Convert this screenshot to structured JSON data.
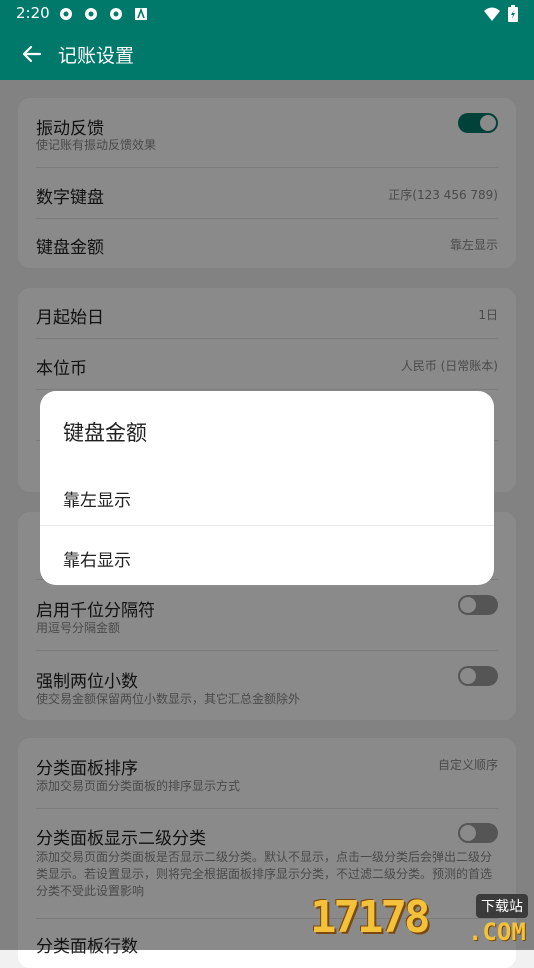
{
  "status_bar": {
    "time": "2:20"
  },
  "app_bar": {
    "title": "记账设置"
  },
  "card1": {
    "vibration": {
      "label": "振动反馈",
      "sub": "使记账有振动反馈效果",
      "on": true
    },
    "numeric_keypad": {
      "label": "数字键盘",
      "value": "正序(123 456 789)"
    },
    "keypad_amount": {
      "label": "键盘金额",
      "value": "靠左显示"
    }
  },
  "card2": {
    "month_start": {
      "label": "月起始日",
      "value": "1日"
    },
    "base_currency": {
      "label": "本位币",
      "value": "人民币 (日常账本)"
    }
  },
  "card3": {
    "thousands": {
      "label": "启用千位分隔符",
      "sub": "用逗号分隔金额",
      "on": false
    },
    "two_decimals": {
      "label": "强制两位小数",
      "sub": "使交易金额保留两位小数显示，其它汇总金额除外",
      "on": false
    }
  },
  "card4": {
    "panel_sort": {
      "label": "分类面板排序",
      "sub": "添加交易页面分类面板的排序显示方式",
      "value": "自定义顺序"
    },
    "panel_sub": {
      "label": "分类面板显示二级分类",
      "sub": "添加交易页面分类面板是否显示二级分类。默认不显示，点击一级分类后会弹出二级分类显示。若设置显示，则将完全根据面板排序显示分类，不过滤二级分类。预测的首选分类不受此设置影响",
      "on": false
    },
    "panel_rows": {
      "label": "分类面板行数"
    }
  },
  "dialog": {
    "title": "键盘金额",
    "options": [
      "靠左显示",
      "靠右显示"
    ]
  },
  "watermark": {
    "text": "17178",
    "badge": "下载站",
    "domain": ".COM"
  },
  "colors": {
    "primary": "#00796b",
    "scrim": "rgba(0,0,0,0.46)"
  }
}
